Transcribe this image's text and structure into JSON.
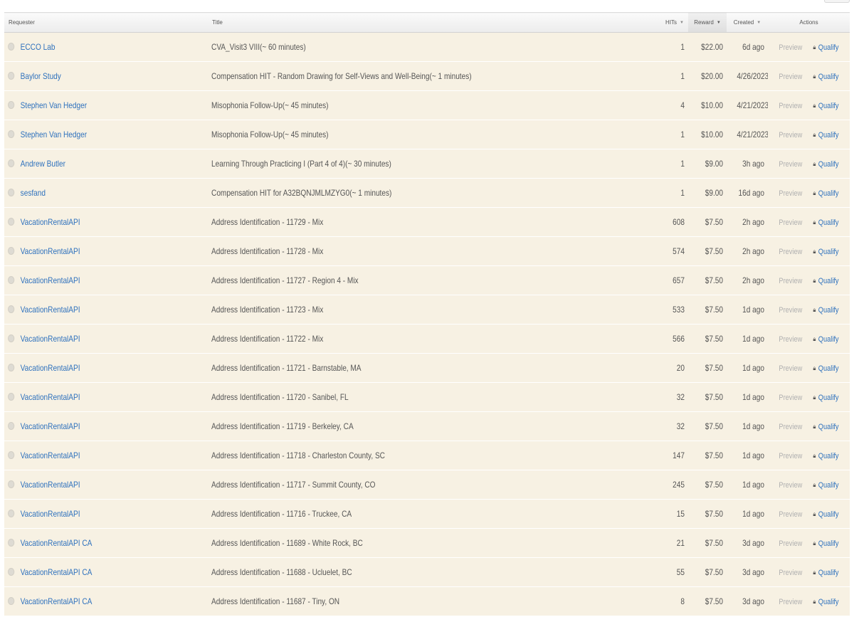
{
  "columns": {
    "requester": "Requester",
    "title": "Title",
    "hits": "HITs",
    "reward": "Reward",
    "created": "Created",
    "actions": "Actions"
  },
  "action_labels": {
    "preview": "Preview",
    "qualify": "Qualify"
  },
  "icons": {
    "expand": "expand-circle-icon",
    "lock": "lock-icon",
    "sort": "sort-caret-icon"
  },
  "colors": {
    "row_background": "#f7f1e3",
    "link": "#2e71bd",
    "preview_disabled": "#b0b0b0",
    "text": "#555555"
  },
  "rows": [
    {
      "requester": "ECCO Lab",
      "title": "CVA_Visit3 VIII(~ 60 minutes)",
      "hits": "1",
      "reward": "$22.00",
      "created": "6d ago"
    },
    {
      "requester": "Baylor Study",
      "title": "Compensation HIT - Random Drawing for Self-Views and Well-Being(~ 1 minutes)",
      "hits": "1",
      "reward": "$20.00",
      "created": "4/26/2023"
    },
    {
      "requester": "Stephen Van Hedger",
      "title": "Misophonia Follow-Up(~ 45 minutes)",
      "hits": "4",
      "reward": "$10.00",
      "created": "4/21/2023"
    },
    {
      "requester": "Stephen Van Hedger",
      "title": "Misophonia Follow-Up(~ 45 minutes)",
      "hits": "1",
      "reward": "$10.00",
      "created": "4/21/2023"
    },
    {
      "requester": "Andrew Butler",
      "title": "Learning Through Practicing I (Part 4 of 4)(~ 30 minutes)",
      "hits": "1",
      "reward": "$9.00",
      "created": "3h ago"
    },
    {
      "requester": "sesfand",
      "title": "Compensation HIT for A32BQNJMLMZYG0(~ 1 minutes)",
      "hits": "1",
      "reward": "$9.00",
      "created": "16d ago"
    },
    {
      "requester": "VacationRentalAPI",
      "title": "Address Identification - 11729 - Mix",
      "hits": "608",
      "reward": "$7.50",
      "created": "2h ago"
    },
    {
      "requester": "VacationRentalAPI",
      "title": "Address Identification - 11728 - Mix",
      "hits": "574",
      "reward": "$7.50",
      "created": "2h ago"
    },
    {
      "requester": "VacationRentalAPI",
      "title": "Address Identification - 11727 - Region 4 - Mix",
      "hits": "657",
      "reward": "$7.50",
      "created": "2h ago"
    },
    {
      "requester": "VacationRentalAPI",
      "title": "Address Identification - 11723 - Mix",
      "hits": "533",
      "reward": "$7.50",
      "created": "1d ago"
    },
    {
      "requester": "VacationRentalAPI",
      "title": "Address Identification - 11722 - Mix",
      "hits": "566",
      "reward": "$7.50",
      "created": "1d ago"
    },
    {
      "requester": "VacationRentalAPI",
      "title": "Address Identification - 11721 - Barnstable, MA",
      "hits": "20",
      "reward": "$7.50",
      "created": "1d ago"
    },
    {
      "requester": "VacationRentalAPI",
      "title": "Address Identification - 11720 - Sanibel, FL",
      "hits": "32",
      "reward": "$7.50",
      "created": "1d ago"
    },
    {
      "requester": "VacationRentalAPI",
      "title": "Address Identification - 11719 - Berkeley, CA",
      "hits": "32",
      "reward": "$7.50",
      "created": "1d ago"
    },
    {
      "requester": "VacationRentalAPI",
      "title": "Address Identification - 11718 - Charleston County, SC",
      "hits": "147",
      "reward": "$7.50",
      "created": "1d ago"
    },
    {
      "requester": "VacationRentalAPI",
      "title": "Address Identification - 11717 - Summit County, CO",
      "hits": "245",
      "reward": "$7.50",
      "created": "1d ago"
    },
    {
      "requester": "VacationRentalAPI",
      "title": "Address Identification - 11716 - Truckee, CA",
      "hits": "15",
      "reward": "$7.50",
      "created": "1d ago"
    },
    {
      "requester": "VacationRentalAPI CA",
      "title": "Address Identification - 11689 - White Rock, BC",
      "hits": "21",
      "reward": "$7.50",
      "created": "3d ago"
    },
    {
      "requester": "VacationRentalAPI CA",
      "title": "Address Identification - 11688 - Ucluelet, BC",
      "hits": "55",
      "reward": "$7.50",
      "created": "3d ago"
    },
    {
      "requester": "VacationRentalAPI CA",
      "title": "Address Identification - 11687 - Tiny, ON",
      "hits": "8",
      "reward": "$7.50",
      "created": "3d ago"
    }
  ]
}
